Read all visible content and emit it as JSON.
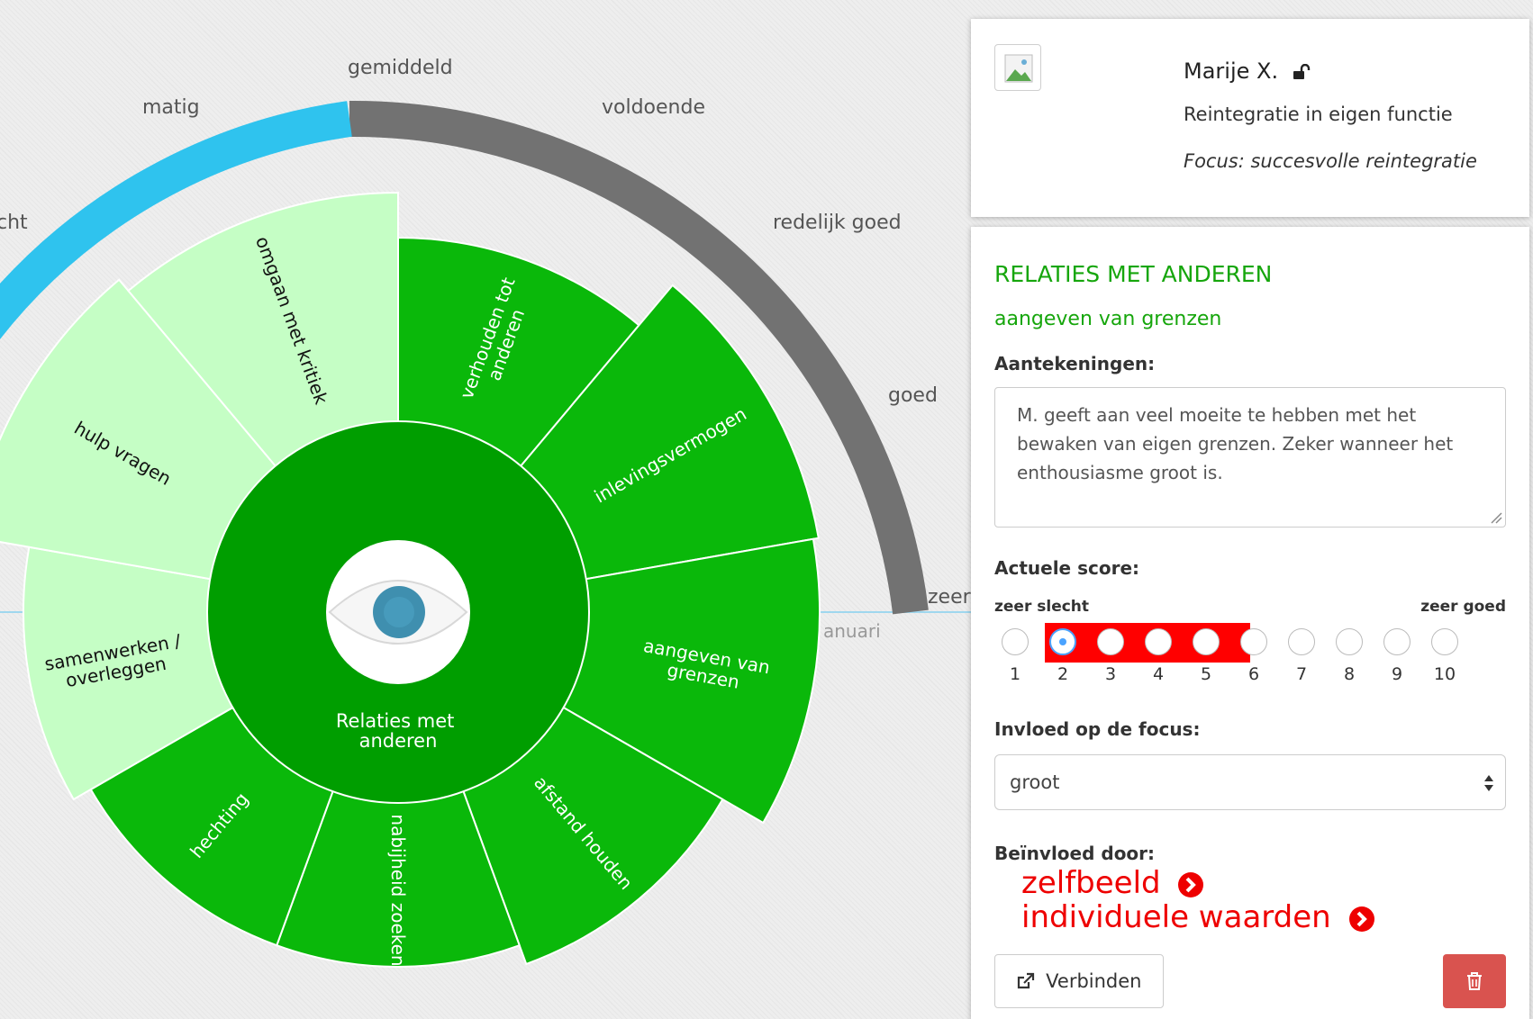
{
  "wheel": {
    "center_label_line1": "Relaties met",
    "center_label_line2": "anderen",
    "center_icon": "eye-icon",
    "gauge_labels": [
      "cht",
      "matig",
      "gemiddeld",
      "voldoende",
      "redelijk goed",
      "goed",
      "zeer"
    ],
    "timeline_label": "anuari",
    "gauge_colors": {
      "fill": "#2fc3ee",
      "track": "#727272"
    },
    "segment_colors": {
      "dark": "#009e00",
      "mid": "#0ab80a",
      "light": "#c5fec5"
    },
    "segments": [
      {
        "line1": "verhouden tot",
        "line2": "anderen"
      },
      {
        "line1": "inlevingsvermogen",
        "line2": ""
      },
      {
        "line1": "aangeven van",
        "line2": "grenzen"
      },
      {
        "line1": "afstand houden",
        "line2": ""
      },
      {
        "line1": "nabijheid zoeken",
        "line2": ""
      },
      {
        "line1": "hechting",
        "line2": ""
      },
      {
        "line1": "samenwerken /",
        "line2": "overleggen"
      },
      {
        "line1": "hulp vragen",
        "line2": ""
      },
      {
        "line1": "omgaan met kritiek",
        "line2": ""
      }
    ]
  },
  "profile": {
    "name": "Marije X.",
    "role": "Reintegratie in eigen functie",
    "focus": "Focus: succesvolle reintegratie",
    "avatar_icon": "broken-image-icon",
    "lock_icon": "unlock-icon"
  },
  "detail": {
    "title": "RELATIES MET ANDEREN",
    "subtitle": "aangeven van grenzen",
    "notes_label": "Aantekeningen:",
    "notes_text": "M. geeft aan veel moeite te hebben met het bewaken van eigen grenzen. Zeker wanneer het enthousiasme groot is.",
    "score_label": "Actuele score:",
    "scale_low": "zeer slecht",
    "scale_high": "zeer goed",
    "score_options": [
      "1",
      "2",
      "3",
      "4",
      "5",
      "6",
      "7",
      "8",
      "9",
      "10"
    ],
    "selected_score": "2",
    "highlight_color": "#ff0000",
    "influence_label": "Invloed op de focus:",
    "influence_value": "groot",
    "influenced_by_label": "Beïnvloed door:",
    "influenced_by": [
      "zelfbeeld",
      "individuele waarden"
    ],
    "connect_button": "Verbinden",
    "connect_icon": "external-link-icon",
    "delete_icon": "trash-icon",
    "delete_color": "#d9534f"
  }
}
